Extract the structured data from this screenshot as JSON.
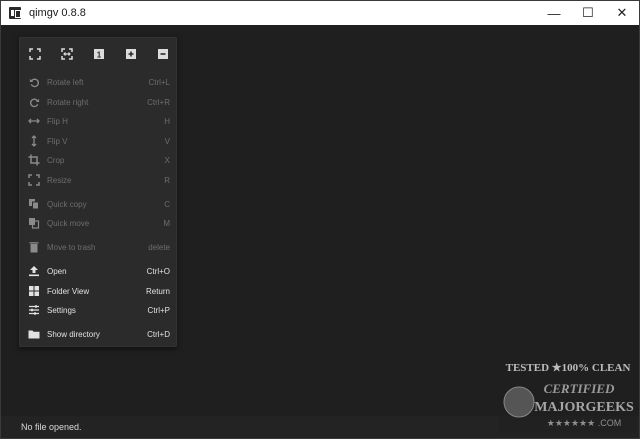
{
  "window": {
    "title": "qimgv 0.8.8",
    "controls": {
      "minimize": "—",
      "maximize": "☐",
      "close": "✕"
    }
  },
  "toolbar": {
    "buttons": [
      "fit-window-icon",
      "fit-width-icon",
      "original-size-icon",
      "zoom-in-icon",
      "zoom-out-icon"
    ],
    "original_size_text": "1"
  },
  "menu": {
    "items": [
      {
        "icon": "rotate-left-icon",
        "label": "Rotate left",
        "shortcut": "Ctrl+L",
        "enabled": false
      },
      {
        "icon": "rotate-right-icon",
        "label": "Rotate right",
        "shortcut": "Ctrl+R",
        "enabled": false
      },
      {
        "icon": "flip-h-icon",
        "label": "Flip H",
        "shortcut": "H",
        "enabled": false
      },
      {
        "icon": "flip-v-icon",
        "label": "Flip V",
        "shortcut": "V",
        "enabled": false
      },
      {
        "icon": "crop-icon",
        "label": "Crop",
        "shortcut": "X",
        "enabled": false
      },
      {
        "icon": "resize-icon",
        "label": "Resize",
        "shortcut": "R",
        "enabled": false
      },
      {
        "icon": "copy-icon",
        "label": "Quick copy",
        "shortcut": "C",
        "enabled": false
      },
      {
        "icon": "move-icon",
        "label": "Quick move",
        "shortcut": "M",
        "enabled": false
      },
      {
        "icon": "trash-icon",
        "label": "Move to trash",
        "shortcut": "delete",
        "enabled": false
      },
      {
        "icon": "open-icon",
        "label": "Open",
        "shortcut": "Ctrl+O",
        "enabled": true
      },
      {
        "icon": "folder-view-icon",
        "label": "Folder View",
        "shortcut": "Return",
        "enabled": true
      },
      {
        "icon": "settings-icon",
        "label": "Settings",
        "shortcut": "Ctrl+P",
        "enabled": true
      },
      {
        "icon": "folder-icon",
        "label": "Show directory",
        "shortcut": "Ctrl+D",
        "enabled": true
      }
    ]
  },
  "status": {
    "text": "No file opened."
  },
  "watermark": {
    "line1": "TESTED ★100% CLEAN",
    "line2": "CERTIFIED",
    "line3": "MAJORGEEKS",
    "line4": "★★★★★★ .COM"
  },
  "colors": {
    "enabled_text": "#e2e2e2",
    "disabled_text": "#6d6d6d",
    "menu_bg": "#2b2b2b",
    "canvas_bg": "#1f1f1f"
  }
}
